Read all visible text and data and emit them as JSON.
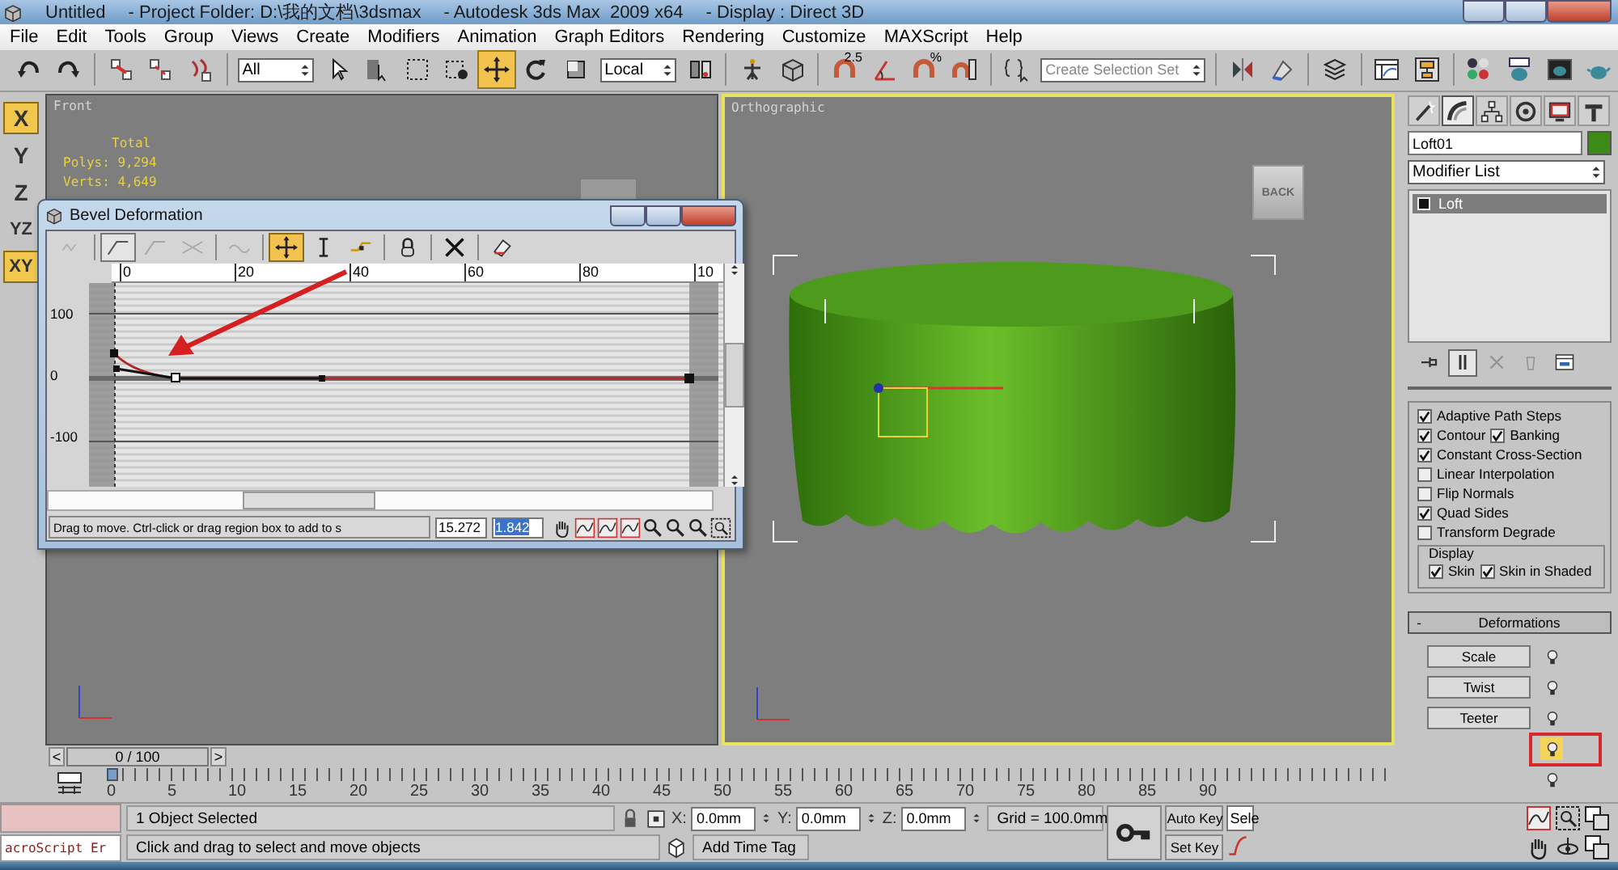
{
  "window": {
    "title_parts": [
      "Untitled",
      "- Project Folder: D:\\我的文档\\3dsmax",
      "- Autodesk 3ds Max  2009 x64",
      "- Display : Direct 3D"
    ]
  },
  "menu": [
    "File",
    "Edit",
    "Tools",
    "Group",
    "Views",
    "Create",
    "Modifiers",
    "Animation",
    "Graph Editors",
    "Rendering",
    "Customize",
    "MAXScript",
    "Help"
  ],
  "toolbar": [
    {
      "kind": "button",
      "selected": false
    },
    {
      "kind": "button",
      "selected": false
    },
    {
      "kind": "separator"
    },
    {
      "kind": "button",
      "selected": false
    },
    {
      "kind": "button",
      "selected": false
    },
    {
      "kind": "button",
      "selected": false
    },
    {
      "kind": "separator"
    },
    {
      "kind": "dropdown",
      "value": "All"
    },
    {
      "kind": "button",
      "selected": false
    },
    {
      "kind": "button",
      "selected": false
    },
    {
      "kind": "button",
      "selected": false
    },
    {
      "kind": "button",
      "selected": false
    },
    {
      "kind": "button",
      "selected": true
    },
    {
      "kind": "button",
      "selected": false
    },
    {
      "kind": "button",
      "selected": false
    },
    {
      "kind": "dropdown",
      "value": "Local"
    },
    {
      "kind": "button",
      "selected": false
    },
    {
      "kind": "separator"
    },
    {
      "kind": "button",
      "selected": false
    },
    {
      "kind": "button",
      "selected": false
    },
    {
      "kind": "separator"
    },
    {
      "kind": "button",
      "selected": false,
      "label": "2.5"
    },
    {
      "kind": "button",
      "selected": false
    },
    {
      "kind": "button",
      "selected": false,
      "label": "%"
    },
    {
      "kind": "button",
      "selected": false
    },
    {
      "kind": "separator"
    },
    {
      "kind": "button",
      "selected": false
    },
    {
      "kind": "dropdown",
      "placeholder": "Create Selection Set"
    },
    {
      "kind": "separator"
    },
    {
      "kind": "button",
      "selected": false
    },
    {
      "kind": "button",
      "selected": false
    },
    {
      "kind": "separator"
    },
    {
      "kind": "button",
      "selected": false
    },
    {
      "kind": "separator"
    },
    {
      "kind": "button",
      "selected": false
    },
    {
      "kind": "button",
      "selected": false
    },
    {
      "kind": "separator"
    },
    {
      "kind": "button",
      "selected": false
    },
    {
      "kind": "button",
      "selected": false
    },
    {
      "kind": "button",
      "selected": false
    },
    {
      "kind": "button",
      "selected": false
    }
  ],
  "axis_constraints": [
    {
      "label": "X",
      "selected": true
    },
    {
      "label": "Y",
      "selected": false
    },
    {
      "label": "Z",
      "selected": false
    },
    {
      "label": "YZ",
      "selected": false
    },
    {
      "label": "XY",
      "selected": true
    }
  ],
  "viewports": [
    {
      "label": "Front",
      "active": false,
      "stats": [
        "Total",
        "Polys: 9,294",
        "Verts: 4,649"
      ]
    },
    {
      "label": "Orthographic",
      "active": true,
      "viewcube": "BACK"
    }
  ],
  "curve_dialog": {
    "title": "Bevel Deformation",
    "toolbar": [
      {
        "kind": "button",
        "selected": false,
        "disabled": true
      },
      {
        "kind": "separator"
      },
      {
        "kind": "button",
        "selected": true,
        "disabled": false
      },
      {
        "kind": "button",
        "selected": false,
        "disabled": true
      },
      {
        "kind": "button",
        "selected": false,
        "disabled": true
      },
      {
        "kind": "separator"
      },
      {
        "kind": "button",
        "selected": false,
        "disabled": true
      },
      {
        "kind": "separator"
      },
      {
        "kind": "button",
        "selected": true,
        "disabled": false
      },
      {
        "kind": "button",
        "selected": false,
        "disabled": false
      },
      {
        "kind": "button",
        "selected": false,
        "disabled": false
      },
      {
        "kind": "separator"
      },
      {
        "kind": "button",
        "selected": false,
        "disabled": false
      },
      {
        "kind": "separator"
      },
      {
        "kind": "button",
        "selected": false,
        "disabled": false
      },
      {
        "kind": "separator"
      },
      {
        "kind": "button",
        "selected": false,
        "disabled": false
      }
    ],
    "ruler": [
      "0",
      "20",
      "40",
      "60",
      "80",
      "10"
    ],
    "y_labels": [
      "100",
      "0",
      "-100"
    ],
    "status": "Drag to move. Ctrl-click or drag region box to add to s",
    "x_value": "15.272",
    "y_value": "1.842",
    "y_value_selected": true
  },
  "command_panel": {
    "tabs": [
      {
        "selected": false
      },
      {
        "selected": true
      },
      {
        "selected": false
      },
      {
        "selected": false
      },
      {
        "selected": false
      },
      {
        "selected": false
      }
    ],
    "object_name": "Loft01",
    "modifier_list": "Modifier List",
    "stack": [
      {
        "label": "Loft",
        "selected": true
      }
    ],
    "stack_tools": [
      {
        "selected": false,
        "disabled": false
      },
      {
        "selected": true,
        "disabled": false
      },
      {
        "selected": false,
        "disabled": true
      },
      {
        "selected": false,
        "disabled": true
      },
      {
        "selected": false,
        "disabled": false
      }
    ],
    "options": [
      [
        {
          "label": "Adaptive Path Steps",
          "checked": true
        }
      ],
      [
        {
          "label": "Contour",
          "checked": true
        },
        {
          "label": "Banking",
          "checked": true
        }
      ],
      [
        {
          "label": "Constant Cross-Section",
          "checked": true
        }
      ],
      [
        {
          "label": "Linear Interpolation",
          "checked": false
        }
      ],
      [
        {
          "label": "Flip Normals",
          "checked": false
        }
      ],
      [
        {
          "label": "Quad Sides",
          "checked": true
        }
      ],
      [
        {
          "label": "Transform Degrade",
          "checked": false
        }
      ]
    ],
    "display_group": {
      "title": "Display",
      "options": [
        {
          "label": "Skin",
          "checked": true
        },
        {
          "label": "Skin in Shaded",
          "checked": true
        }
      ]
    },
    "deformations": {
      "toggle": "-",
      "title": "Deformations",
      "items": [
        {
          "label": "Scale",
          "on": false,
          "highlighted": false
        },
        {
          "label": "Twist",
          "on": false,
          "highlighted": false
        },
        {
          "label": "Teeter",
          "on": false,
          "highlighted": false
        },
        {
          "on": true,
          "highlighted": true
        },
        {
          "on": false,
          "highlighted": false
        }
      ]
    }
  },
  "time_slider": {
    "prev": "<",
    "label": "0 / 100",
    "next": ">"
  },
  "track_ruler": [
    {
      "label": "0",
      "current": true
    },
    {
      "label": "5",
      "current": false
    },
    {
      "label": "10",
      "current": false
    },
    {
      "label": "15",
      "current": false
    },
    {
      "label": "20",
      "current": false
    },
    {
      "label": "25",
      "current": false
    },
    {
      "label": "30",
      "current": false
    },
    {
      "label": "35",
      "current": false
    },
    {
      "label": "40",
      "current": false
    },
    {
      "label": "45",
      "current": false
    },
    {
      "label": "50",
      "current": false
    },
    {
      "label": "55",
      "current": false
    },
    {
      "label": "60",
      "current": false
    },
    {
      "label": "65",
      "current": false
    },
    {
      "label": "70",
      "current": false
    },
    {
      "label": "75",
      "current": false
    },
    {
      "label": "80",
      "current": false
    },
    {
      "label": "85",
      "current": false
    },
    {
      "label": "90",
      "current": false
    }
  ],
  "status_bar": {
    "listener": "acroScript Er",
    "selection": "1 Object Selected",
    "prompt": "Click and drag to select and move objects",
    "coords": [
      {
        "axis": "X:",
        "value": "0.0mm"
      },
      {
        "axis": "Y:",
        "value": "0.0mm"
      },
      {
        "axis": "Z:",
        "value": "0.0mm"
      }
    ],
    "grid": "Grid = 100.0mm",
    "time_tag": "Add Time Tag",
    "auto_key": "Auto Key",
    "set_key": "Set Key",
    "selection_set": "Sele"
  }
}
